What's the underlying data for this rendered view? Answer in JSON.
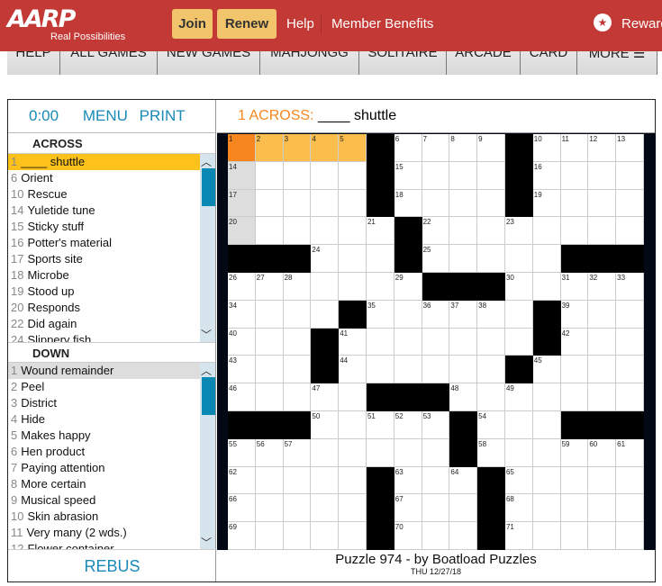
{
  "header": {
    "logo": "AARP",
    "tagline": "Real Possibilities",
    "join": "Join",
    "renew": "Renew",
    "help": "Help",
    "member_benefits": "Member Benefits",
    "rewards": "Rewards",
    "brand_color": "#c33935"
  },
  "nav": [
    "HELP",
    "ALL GAMES",
    "NEW GAMES",
    "MAHJONGG",
    "SOLITAIRE",
    "ARCADE",
    "CARD",
    "MORE ☰"
  ],
  "toolbar": {
    "timer": "0:00",
    "menu": "MENU",
    "print": "PRINT"
  },
  "current_clue": {
    "label": "1 ACROSS:",
    "text": "____ shuttle"
  },
  "across": {
    "title": "ACROSS",
    "items": [
      [
        "1",
        "____ shuttle"
      ],
      [
        "6",
        "Orient"
      ],
      [
        "10",
        "Rescue"
      ],
      [
        "14",
        "Yuletide tune"
      ],
      [
        "15",
        "Sticky stuff"
      ],
      [
        "16",
        "Potter's material"
      ],
      [
        "17",
        "Sports site"
      ],
      [
        "18",
        "Microbe"
      ],
      [
        "19",
        "Stood up"
      ],
      [
        "20",
        "Responds"
      ],
      [
        "22",
        "Did again"
      ],
      [
        "24",
        "Slippery fish"
      ]
    ]
  },
  "down": {
    "title": "DOWN",
    "items": [
      [
        "1",
        "Wound remainder"
      ],
      [
        "2",
        "Peel"
      ],
      [
        "3",
        "District"
      ],
      [
        "4",
        "Hide"
      ],
      [
        "5",
        "Makes happy"
      ],
      [
        "6",
        "Hen product"
      ],
      [
        "7",
        "Paying attention"
      ],
      [
        "8",
        "More certain"
      ],
      [
        "9",
        "Musical speed"
      ],
      [
        "10",
        "Skin abrasion"
      ],
      [
        "11",
        "Very many (2 wds.)"
      ],
      [
        "12",
        "Flower container"
      ]
    ]
  },
  "rebus": "REBUS",
  "grid": [
    ".....#....#....",
    ".....#....#....",
    ".....#....#....",
    "......#........",
    "###...#.....###",
    ".......###.....",
    "....#......#...",
    "...#.......#...",
    "...#......#....",
    ".....###.......",
    "###.....#...###",
    "........#......",
    ".....#...#.....",
    ".....#...#.....",
    ".....#...#....."
  ],
  "puzzle": {
    "title": "Puzzle 974 - by Boatload Puzzles",
    "date": "THU 12/27/18"
  }
}
